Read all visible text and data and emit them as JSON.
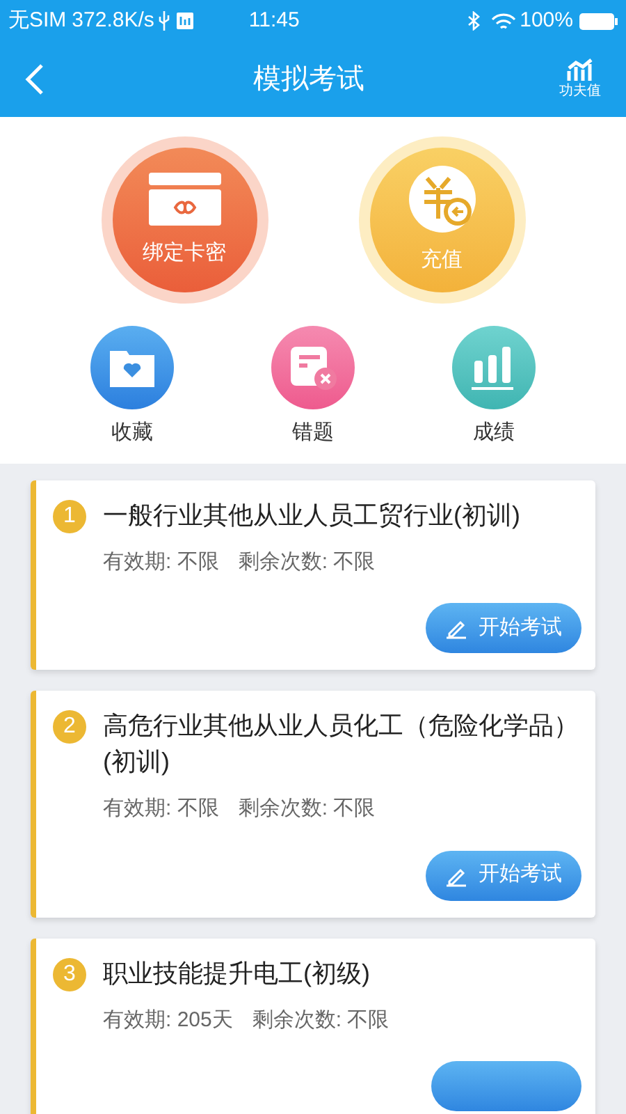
{
  "status_bar": {
    "carrier": "无SIM",
    "speed": "372.8K/s",
    "time": "11:45",
    "battery": "100%"
  },
  "nav": {
    "title": "模拟考试",
    "right_label": "功夫值"
  },
  "big_actions": [
    {
      "kind": "card",
      "label": "绑定卡密"
    },
    {
      "kind": "recharge",
      "label": "充值"
    }
  ],
  "small_actions": [
    {
      "kind": "favorite",
      "label": "收藏"
    },
    {
      "kind": "wrong",
      "label": "错题"
    },
    {
      "kind": "score",
      "label": "成绩"
    }
  ],
  "exams": [
    {
      "number": "1",
      "title": "一般行业其他从业人员工贸行业(初训)",
      "validity": "有效期: 不限",
      "remaining": "剩余次数: 不限",
      "button": "开始考试"
    },
    {
      "number": "2",
      "title": "高危行业其他从业人员化工（危险化学品）(初训)",
      "validity": "有效期: 不限",
      "remaining": "剩余次数: 不限",
      "button": "开始考试"
    },
    {
      "number": "3",
      "title": "职业技能提升电工(初级)",
      "validity": "有效期: 205天",
      "remaining": "剩余次数: 不限"
    }
  ]
}
